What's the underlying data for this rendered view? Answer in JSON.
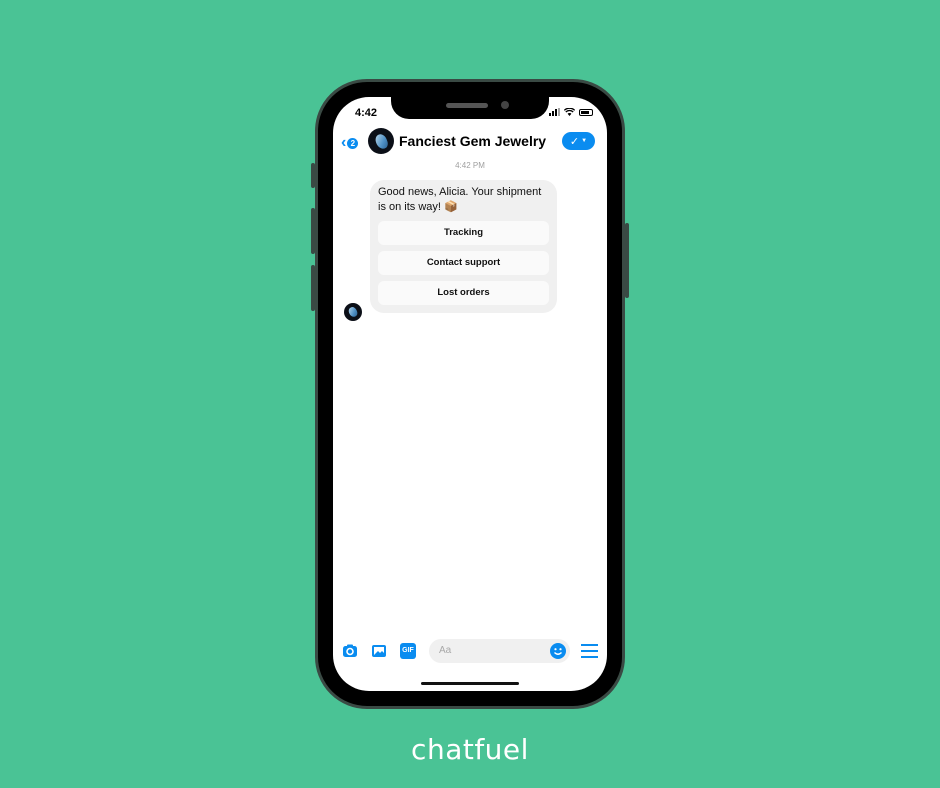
{
  "status_bar": {
    "time": "4:42"
  },
  "header": {
    "back_badge": "2",
    "title": "Fanciest Gem Jewelry",
    "check_icon": "checkmark-icon",
    "dropdown_icon": "caret-down-icon"
  },
  "conversation": {
    "timestamp": "4:42 PM",
    "message": {
      "text": "Good news, Alicia. Your shipment is on its way! 📦",
      "quick_replies": [
        "Tracking",
        "Contact support",
        "Lost orders"
      ]
    }
  },
  "composer": {
    "placeholder": "Aa",
    "gif_label": "GIF",
    "icons": [
      "camera-icon",
      "image-icon",
      "gif-icon",
      "emoji-icon",
      "menu-icon"
    ]
  },
  "brand": {
    "name": "chatfuel"
  },
  "colors": {
    "background": "#4ac395",
    "accent": "#0a8cf0"
  }
}
